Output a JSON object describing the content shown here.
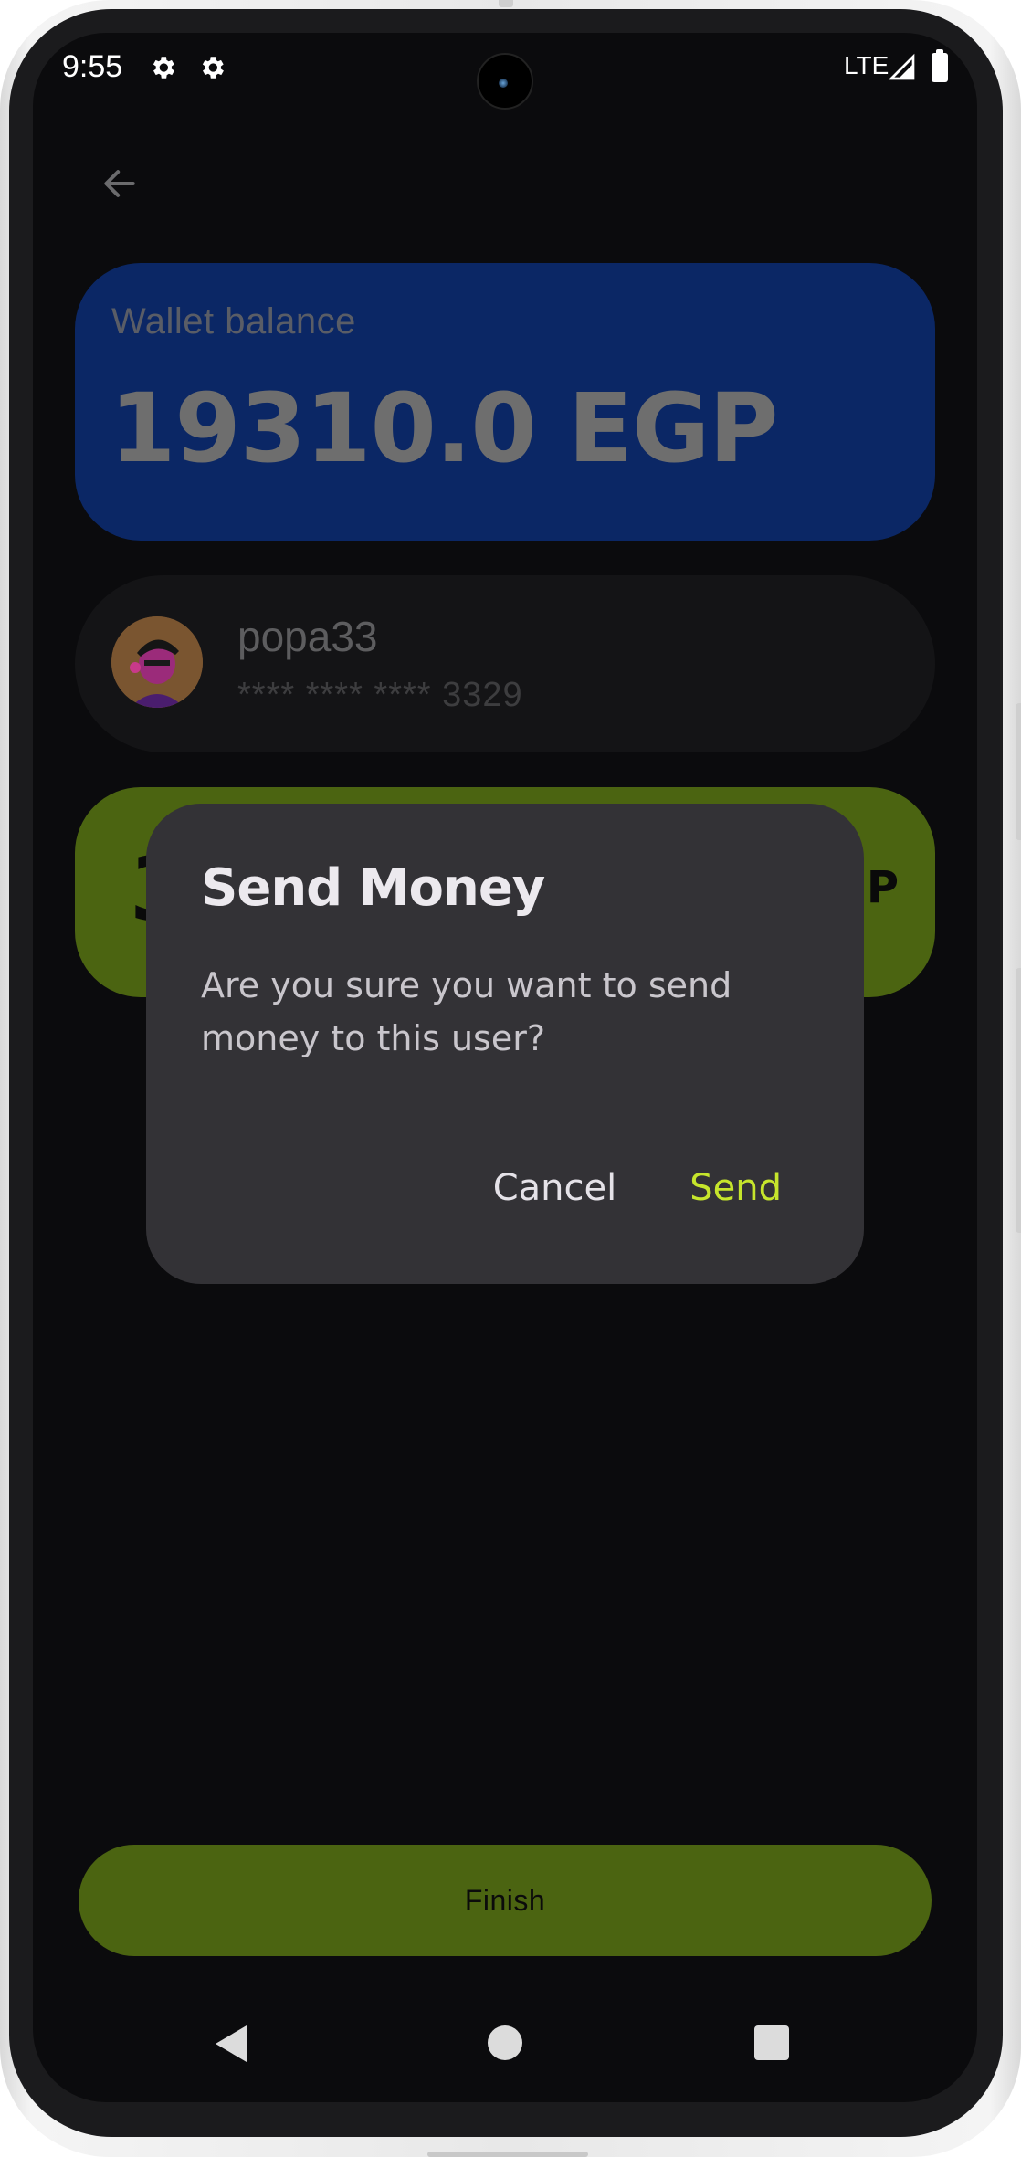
{
  "status_bar": {
    "time": "9:55",
    "network": "LTE",
    "icons": [
      "gear-icon",
      "gear-icon",
      "signal-icon",
      "battery-icon"
    ]
  },
  "header": {
    "back_icon": "arrow-left-icon"
  },
  "wallet": {
    "label": "Wallet balance",
    "amount": "19310.0 EGP"
  },
  "recipient": {
    "username": "popa33",
    "card_number": "**** **** **** 3329"
  },
  "amount_card": {
    "visible_left": "3",
    "visible_right": "GP"
  },
  "dialog": {
    "title": "Send Money",
    "message": "Are you sure you want to send money to this user?",
    "cancel_label": "Cancel",
    "send_label": "Send"
  },
  "footer": {
    "finish_label": "Finish"
  },
  "colors": {
    "background": "#0b0b0d",
    "balance_card": "#0b2765",
    "accent_dim": "#4b6411",
    "dialog_bg": "#333236",
    "send_accent": "#c6e52c"
  }
}
